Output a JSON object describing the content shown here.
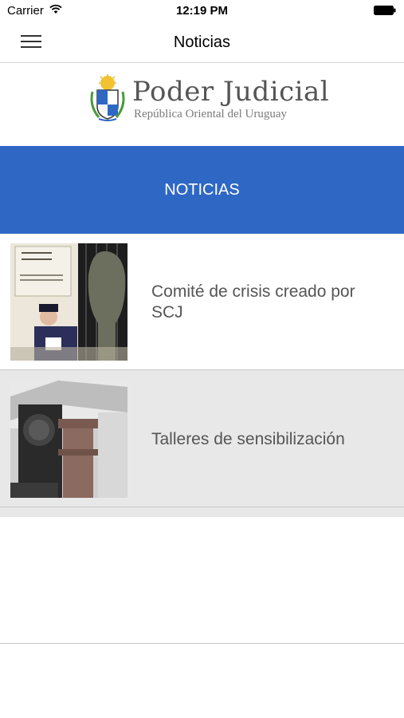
{
  "status_bar": {
    "carrier": "Carrier",
    "time": "12:19 PM"
  },
  "nav": {
    "title": "Noticias",
    "menu_icon": "hamburger-menu-icon"
  },
  "brand": {
    "title": "Poder Judicial",
    "subtitle": "República Oriental del Uruguay"
  },
  "banner": {
    "label": "NOTICIAS",
    "color": "#2f67c5"
  },
  "news": [
    {
      "title": "Comité de crisis creado por SCJ"
    },
    {
      "title": "Talleres de sensibilización"
    }
  ]
}
